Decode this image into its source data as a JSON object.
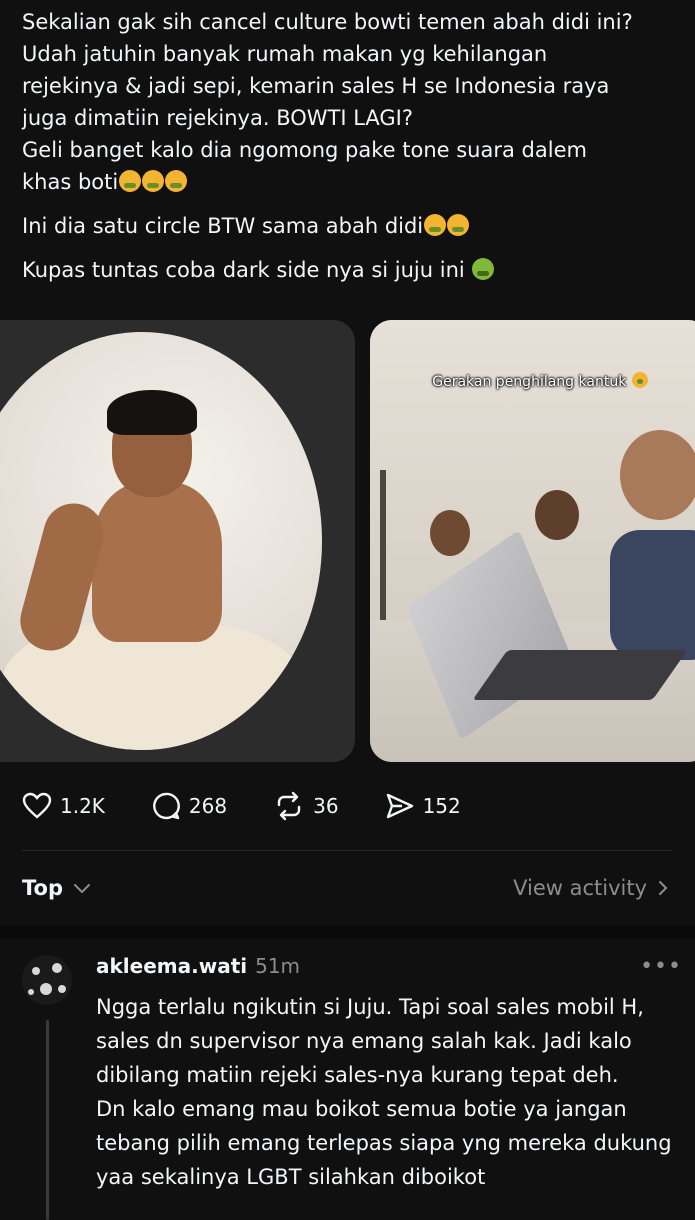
{
  "post": {
    "para1_lines": "Sekalian gak sih cancel culture bowti temen abah didi ini?\nUdah jatuhin banyak rumah makan yg kehilangan\nrejekinya & jadi sepi, kemarin sales H se Indonesia raya\njuga dimatiin rejekinya. BOWTI LAGI?\nGeli banget kalo dia ngomong pake tone suara dalem\nkhas boti",
    "para2": "Ini dia satu circle BTW sama abah didi",
    "para3": "Kupas tuntas coba dark side nya si juju ini",
    "media_caption": "Gerakan penghilang kantuk",
    "emoji_icon": "tired-face-emoji",
    "green_emoji_icon": "nauseated-face-emoji"
  },
  "stats": {
    "likes": "1.2K",
    "replies": "268",
    "reposts": "36",
    "shares": "152"
  },
  "sort": {
    "label": "Top",
    "view_activity": "View activity"
  },
  "reply": {
    "username": "akleema.wati",
    "time": "51m",
    "more": "•••",
    "text": "Ngga terlalu ngikutin si Juju. Tapi soal sales mobil H,\nsales dn supervisor nya emang salah kak. Jadi kalo\ndibilang matiin rejeki sales-nya kurang tepat deh.\nDn kalo emang mau boikot semua  botie ya jangan\ntebang pilih emang terlepas siapa yng mereka dukung\nyaa sekalinya LGBT silahkan diboikot"
  }
}
